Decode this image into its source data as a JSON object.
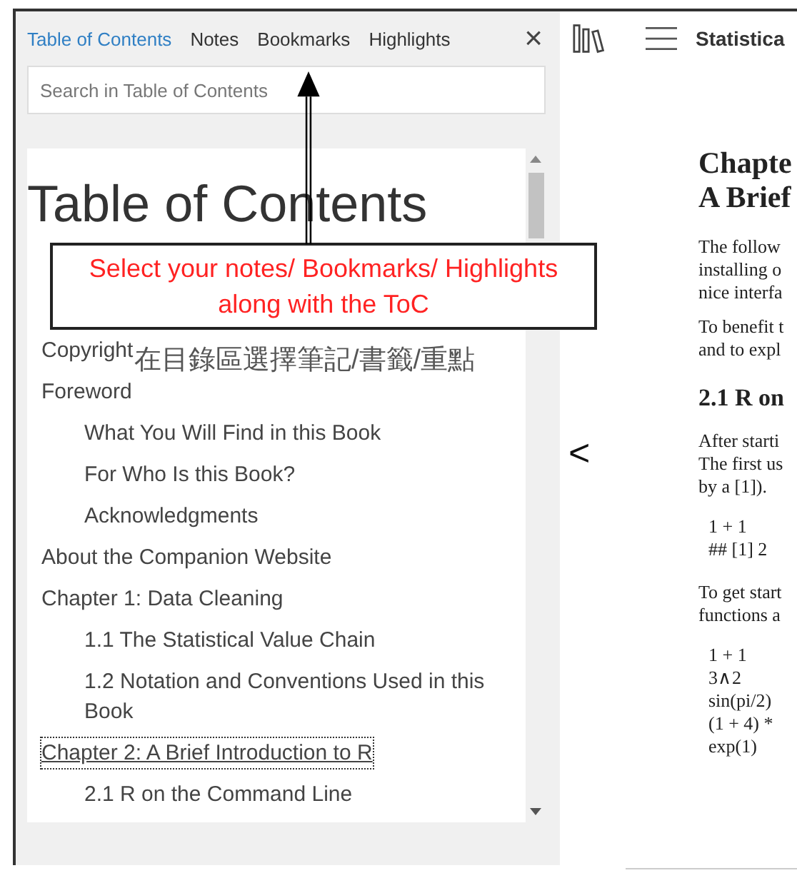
{
  "panel": {
    "tabs": [
      {
        "label": "Table of Contents",
        "selected": true
      },
      {
        "label": "Notes",
        "selected": false
      },
      {
        "label": "Bookmarks",
        "selected": false
      },
      {
        "label": "Highlights",
        "selected": false
      }
    ],
    "close": "×",
    "search": {
      "placeholder": "Search in Table of Contents"
    },
    "toc": {
      "heading": "Table of Contents",
      "items": [
        {
          "text": "Copyright",
          "focused": false
        },
        {
          "text": "Foreword",
          "focused": false,
          "children": [
            {
              "text": "What You Will Find in this Book",
              "focused": false
            },
            {
              "text": "For Who Is this Book?",
              "focused": false
            },
            {
              "text": "Acknowledgments",
              "focused": false
            }
          ]
        },
        {
          "text": "About the Companion Website",
          "focused": false
        },
        {
          "text": "Chapter 1: Data Cleaning",
          "focused": false,
          "children": [
            {
              "text": "1.1 The Statistical Value Chain",
              "focused": false
            },
            {
              "text": "1.2 Notation and Conventions Used in this Book",
              "focused": false
            }
          ]
        },
        {
          "text": "Chapter 2: A Brief Introduction to R",
          "focused": true,
          "children": [
            {
              "text": "2.1 R on the Command Line",
              "focused": false
            }
          ]
        }
      ]
    }
  },
  "reader": {
    "title": "Statistica",
    "prev": "<",
    "heading": [
      "Chapte",
      "A Brief"
    ],
    "blocks": [
      {
        "kind": "para",
        "lines": [
          "The follow",
          "installing o",
          "nice interfa"
        ]
      },
      {
        "kind": "para",
        "lines": [
          "To benefit t",
          "and to expl"
        ]
      },
      {
        "kind": "heading",
        "lines": [
          "2.1 R on"
        ]
      },
      {
        "kind": "para",
        "lines": [
          "After starti",
          "The first us",
          "by a [1])."
        ]
      },
      {
        "kind": "code",
        "lines": [
          "1 + 1",
          "## [1] 2"
        ]
      },
      {
        "kind": "para",
        "lines": [
          "To get start",
          "functions a"
        ]
      },
      {
        "kind": "code",
        "lines": [
          "1 + 1",
          "3∧2",
          "sin(pi/2)",
          "(1 + 4) *",
          "exp(1)"
        ]
      }
    ]
  },
  "annotations": {
    "callout": "Select your notes/ Bookmarks/ Highlights along with the ToC",
    "caption": "在目錄區選擇筆記/書籤/重點"
  }
}
